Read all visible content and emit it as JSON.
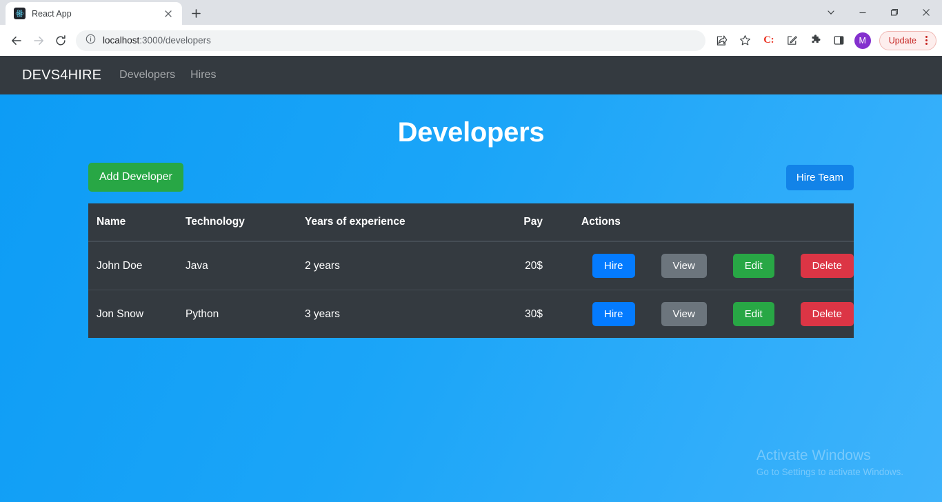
{
  "browser": {
    "tab": {
      "title": "React App",
      "favicon": "react-logo-icon",
      "close": "close-icon"
    },
    "new_tab": "new-tab-icon",
    "window_controls": {
      "tab_search": "chevron-down-icon",
      "minimize": "minimize-icon",
      "maximize": "maximize-icon",
      "close": "close-icon"
    },
    "nav": {
      "back": "back-arrow-icon",
      "forward": "forward-arrow-icon",
      "reload": "reload-icon"
    },
    "omnibox": {
      "site_info_icon": "info-circle-icon",
      "host": "localhost",
      "path": ":3000/developers",
      "full_url": "localhost:3000/developers"
    },
    "toolbar_right": {
      "share": "share-icon",
      "bookmark": "star-icon",
      "extension_c": "C:",
      "edit": "edit-square-icon",
      "extensions": "puzzle-piece-icon",
      "side_panel": "side-panel-icon",
      "profile_initial": "M",
      "update_label": "Update",
      "menu": "three-dot-menu-icon"
    }
  },
  "app": {
    "navbar": {
      "brand": "DEVS4HIRE",
      "links": [
        {
          "label": "Developers"
        },
        {
          "label": "Hires"
        }
      ]
    },
    "page_title": "Developers",
    "buttons": {
      "add_developer": "Add Developer",
      "hire_team": "Hire Team"
    },
    "table": {
      "columns": [
        "Name",
        "Technology",
        "Years of experience",
        "Pay",
        "Actions"
      ],
      "rows": [
        {
          "name": "John Doe",
          "technology": "Java",
          "years": "2 years",
          "pay": "20$",
          "actions": [
            "Hire",
            "View",
            "Edit",
            "Delete"
          ]
        },
        {
          "name": "Jon Snow",
          "technology": "Python",
          "years": "3 years",
          "pay": "30$",
          "actions": [
            "Hire",
            "View",
            "Edit",
            "Delete"
          ]
        }
      ]
    },
    "watermark": {
      "title": "Activate Windows",
      "subtitle": "Go to Settings to activate Windows."
    },
    "colors": {
      "navbar": "#343a40",
      "page_background": "#1ba5f8",
      "add_button": "#28a745",
      "hire_team_button": "#1283e8",
      "hire_button": "#047bff",
      "view_button": "#6c757d",
      "edit_button": "#28a745",
      "delete_button": "#dc3545"
    }
  }
}
